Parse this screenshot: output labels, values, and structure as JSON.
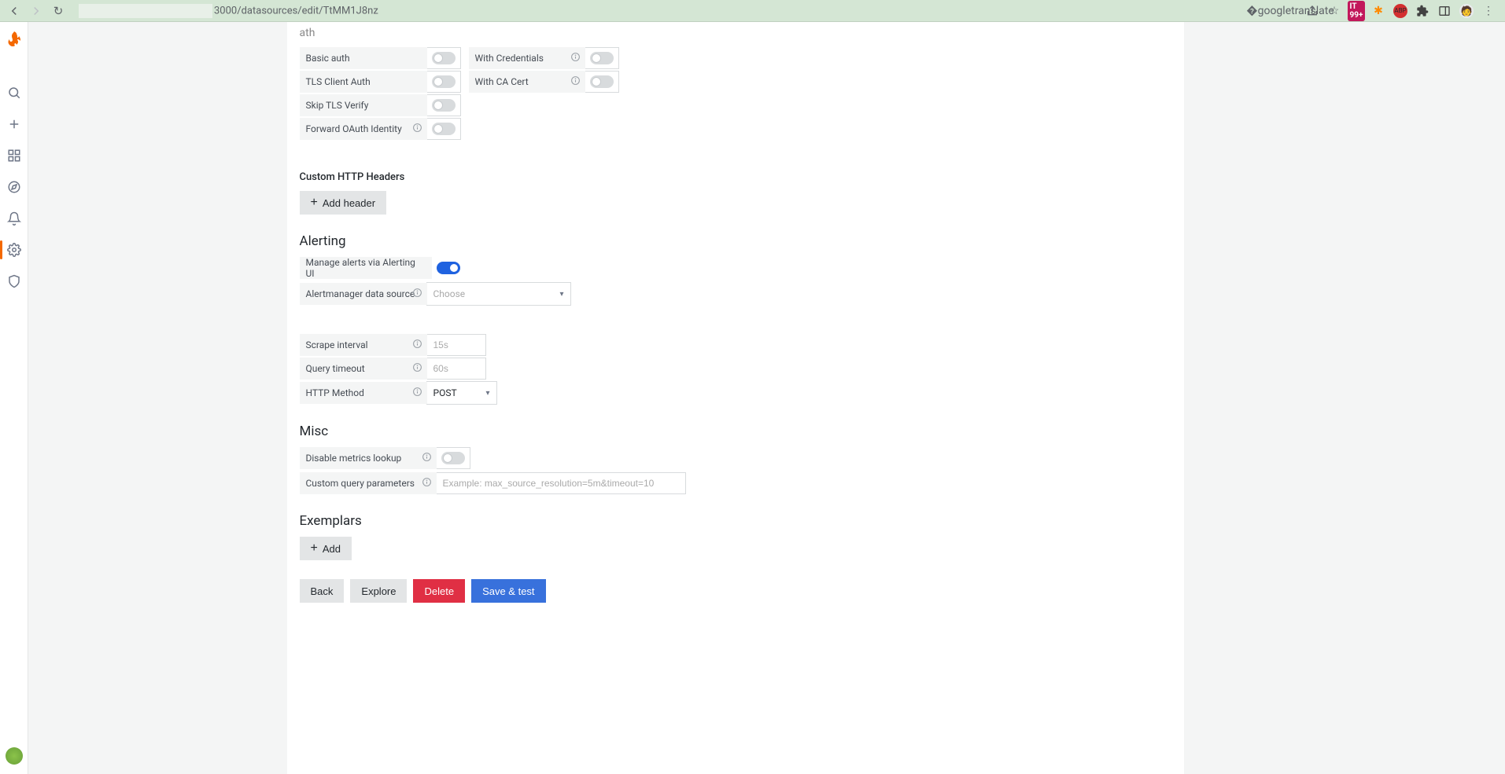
{
  "browser": {
    "url_visible": "3000/datasources/edit/TtMM1J8nz"
  },
  "sections": {
    "auth_heading": "ath",
    "auth": {
      "basic_auth": "Basic auth",
      "with_credentials": "With Credentials",
      "tls_client_auth": "TLS Client Auth",
      "with_ca_cert": "With CA Cert",
      "skip_tls_verify": "Skip TLS Verify",
      "forward_oauth": "Forward OAuth Identity"
    },
    "custom_headers_heading": "Custom HTTP Headers",
    "add_header_btn": "Add header",
    "alerting_heading": "Alerting",
    "alerting": {
      "manage_alerts": "Manage alerts via Alerting UI",
      "alertmanager_ds": "Alertmanager data source",
      "alertmanager_placeholder": "Choose",
      "scrape_interval": "Scrape interval",
      "scrape_placeholder": "15s",
      "query_timeout": "Query timeout",
      "query_timeout_placeholder": "60s",
      "http_method": "HTTP Method",
      "http_method_value": "POST"
    },
    "misc_heading": "Misc",
    "misc": {
      "disable_metrics": "Disable metrics lookup",
      "custom_query_params": "Custom query parameters",
      "custom_query_placeholder": "Example: max_source_resolution=5m&timeout=10"
    },
    "exemplars_heading": "Exemplars",
    "add_btn": "Add"
  },
  "footer": {
    "back": "Back",
    "explore": "Explore",
    "delete": "Delete",
    "save": "Save & test"
  }
}
